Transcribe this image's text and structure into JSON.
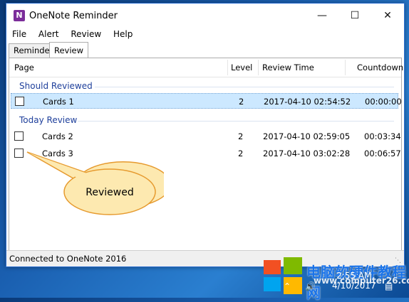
{
  "window": {
    "title": "OneNote Reminder"
  },
  "menu": [
    "File",
    "Alert",
    "Review",
    "Help"
  ],
  "tabs": [
    "Reminder",
    "Review"
  ],
  "columns": {
    "page": "Page",
    "level": "Level",
    "review_time": "Review Time",
    "countdown": "Countdown"
  },
  "groups": {
    "should": {
      "label": "Should Reviewed",
      "rows": [
        {
          "page": "Cards 1",
          "level": "2",
          "time": "2017-04-10 02:54:52",
          "countdown": "00:00:00"
        }
      ]
    },
    "today": {
      "label": "Today Review",
      "rows": [
        {
          "page": "Cards 2",
          "level": "2",
          "time": "2017-04-10 02:59:05",
          "countdown": "00:03:34"
        },
        {
          "page": "Cards 3",
          "level": "2",
          "time": "2017-04-10 03:02:28",
          "countdown": "00:06:57"
        }
      ]
    }
  },
  "callout": "Reviewed",
  "status": "Connected to OneNote 2016",
  "taskbar": {
    "time": "2:55 AM",
    "date": "4/10/2017"
  },
  "watermark": {
    "line1": "电脑软硬件教程网",
    "line2": "www.computer26.com"
  },
  "colors": {
    "group_text": "#1e3f9b",
    "selection": "#cce8ff",
    "callout_fill": "#fde9b0",
    "callout_border": "#e69a2e"
  }
}
